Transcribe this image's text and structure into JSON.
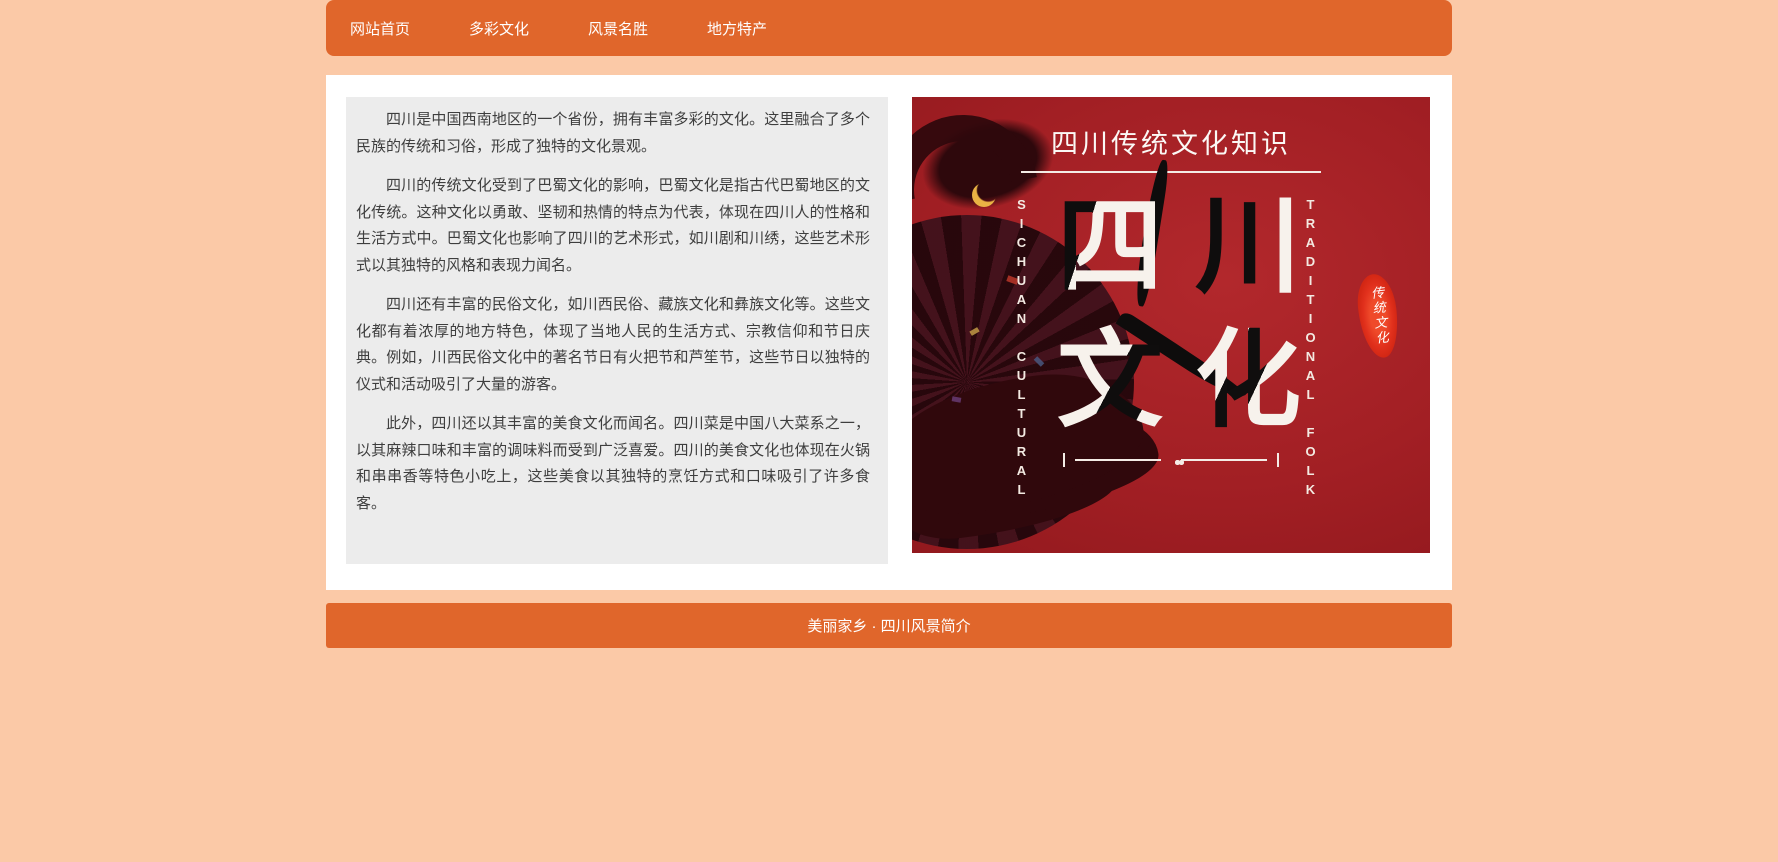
{
  "nav": {
    "items": [
      {
        "label": "网站首页"
      },
      {
        "label": "多彩文化"
      },
      {
        "label": "风景名胜"
      },
      {
        "label": "地方特产"
      }
    ]
  },
  "article": {
    "paragraphs": [
      "四川是中国西南地区的一个省份，拥有丰富多彩的文化。这里融合了多个民族的传统和习俗，形成了独特的文化景观。",
      "四川的传统文化受到了巴蜀文化的影响，巴蜀文化是指古代巴蜀地区的文化传统。这种文化以勇敢、坚韧和热情的特点为代表，体现在四川人的性格和生活方式中。巴蜀文化也影响了四川的艺术形式，如川剧和川绣，这些艺术形式以其独特的风格和表现力闻名。",
      "四川还有丰富的民俗文化，如川西民俗、藏族文化和彝族文化等。这些文化都有着浓厚的地方特色，体现了当地人民的生活方式、宗教信仰和节日庆典。例如，川西民俗文化中的著名节日有火把节和芦笙节，这些节日以独特的仪式和活动吸引了大量的游客。",
      "此外，四川还以其丰富的美食文化而闻名。四川菜是中国八大菜系之一，以其麻辣口味和丰富的调味料而受到广泛喜爱。四川的美食文化也体现在火锅和串串香等特色小吃上，这些美食以其独特的烹饪方式和口味吸引了许多食客。"
    ]
  },
  "poster": {
    "title": "四川传统文化知识",
    "side_left": "SICHUAN CULTURAL",
    "side_right": "TRADITIONAL FOLK",
    "chars": {
      "c1": "四",
      "c2": "川",
      "c3": "文",
      "c4": "化"
    },
    "seal": "传统文化"
  },
  "footer": {
    "text": "美丽家乡 · 四川风景简介"
  },
  "colors": {
    "accent_orange": "#e0662b",
    "page_bg": "#fbc9a7",
    "poster_red": "#a21f24",
    "panel_gray": "#ececec",
    "seal_red": "#e1301c"
  }
}
